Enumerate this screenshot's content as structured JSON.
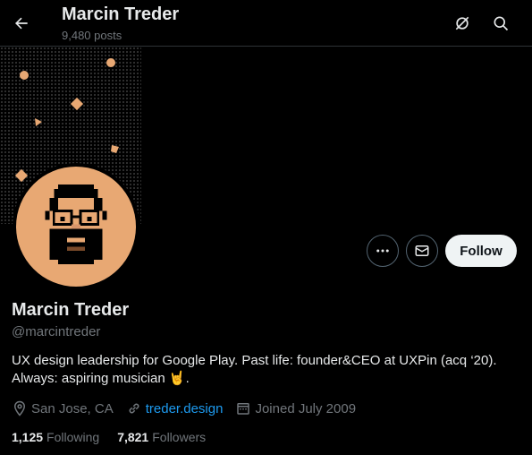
{
  "header": {
    "title": "Marcin Treder",
    "posts_count": "9,480 posts",
    "back_icon": "arrow-left-icon",
    "grok_icon": "grok-icon",
    "search_icon": "search-icon"
  },
  "profile": {
    "name": "Marcin Treder",
    "handle": "@marcintreder",
    "bio_line1": "UX design leadership for Google Play. Past life: founder&CEO at UXPin (acq ‘20).",
    "bio_line2": "Always: aspiring musician",
    "bio_emoji": "🤘",
    "bio_end": ".",
    "location": "San Jose, CA",
    "website": "treder.design",
    "joined": "Joined July 2009",
    "following_count": "1,125",
    "following_label": "Following",
    "followers_count": "7,821",
    "followers_label": "Followers"
  },
  "actions": {
    "follow_label": "Follow",
    "more_icon": "more-icon",
    "message_icon": "mail-icon"
  },
  "colors": {
    "background": "#000000",
    "accent_link": "#1d9bf0",
    "avatar_bg": "#e8a873",
    "muted": "#71767b"
  }
}
